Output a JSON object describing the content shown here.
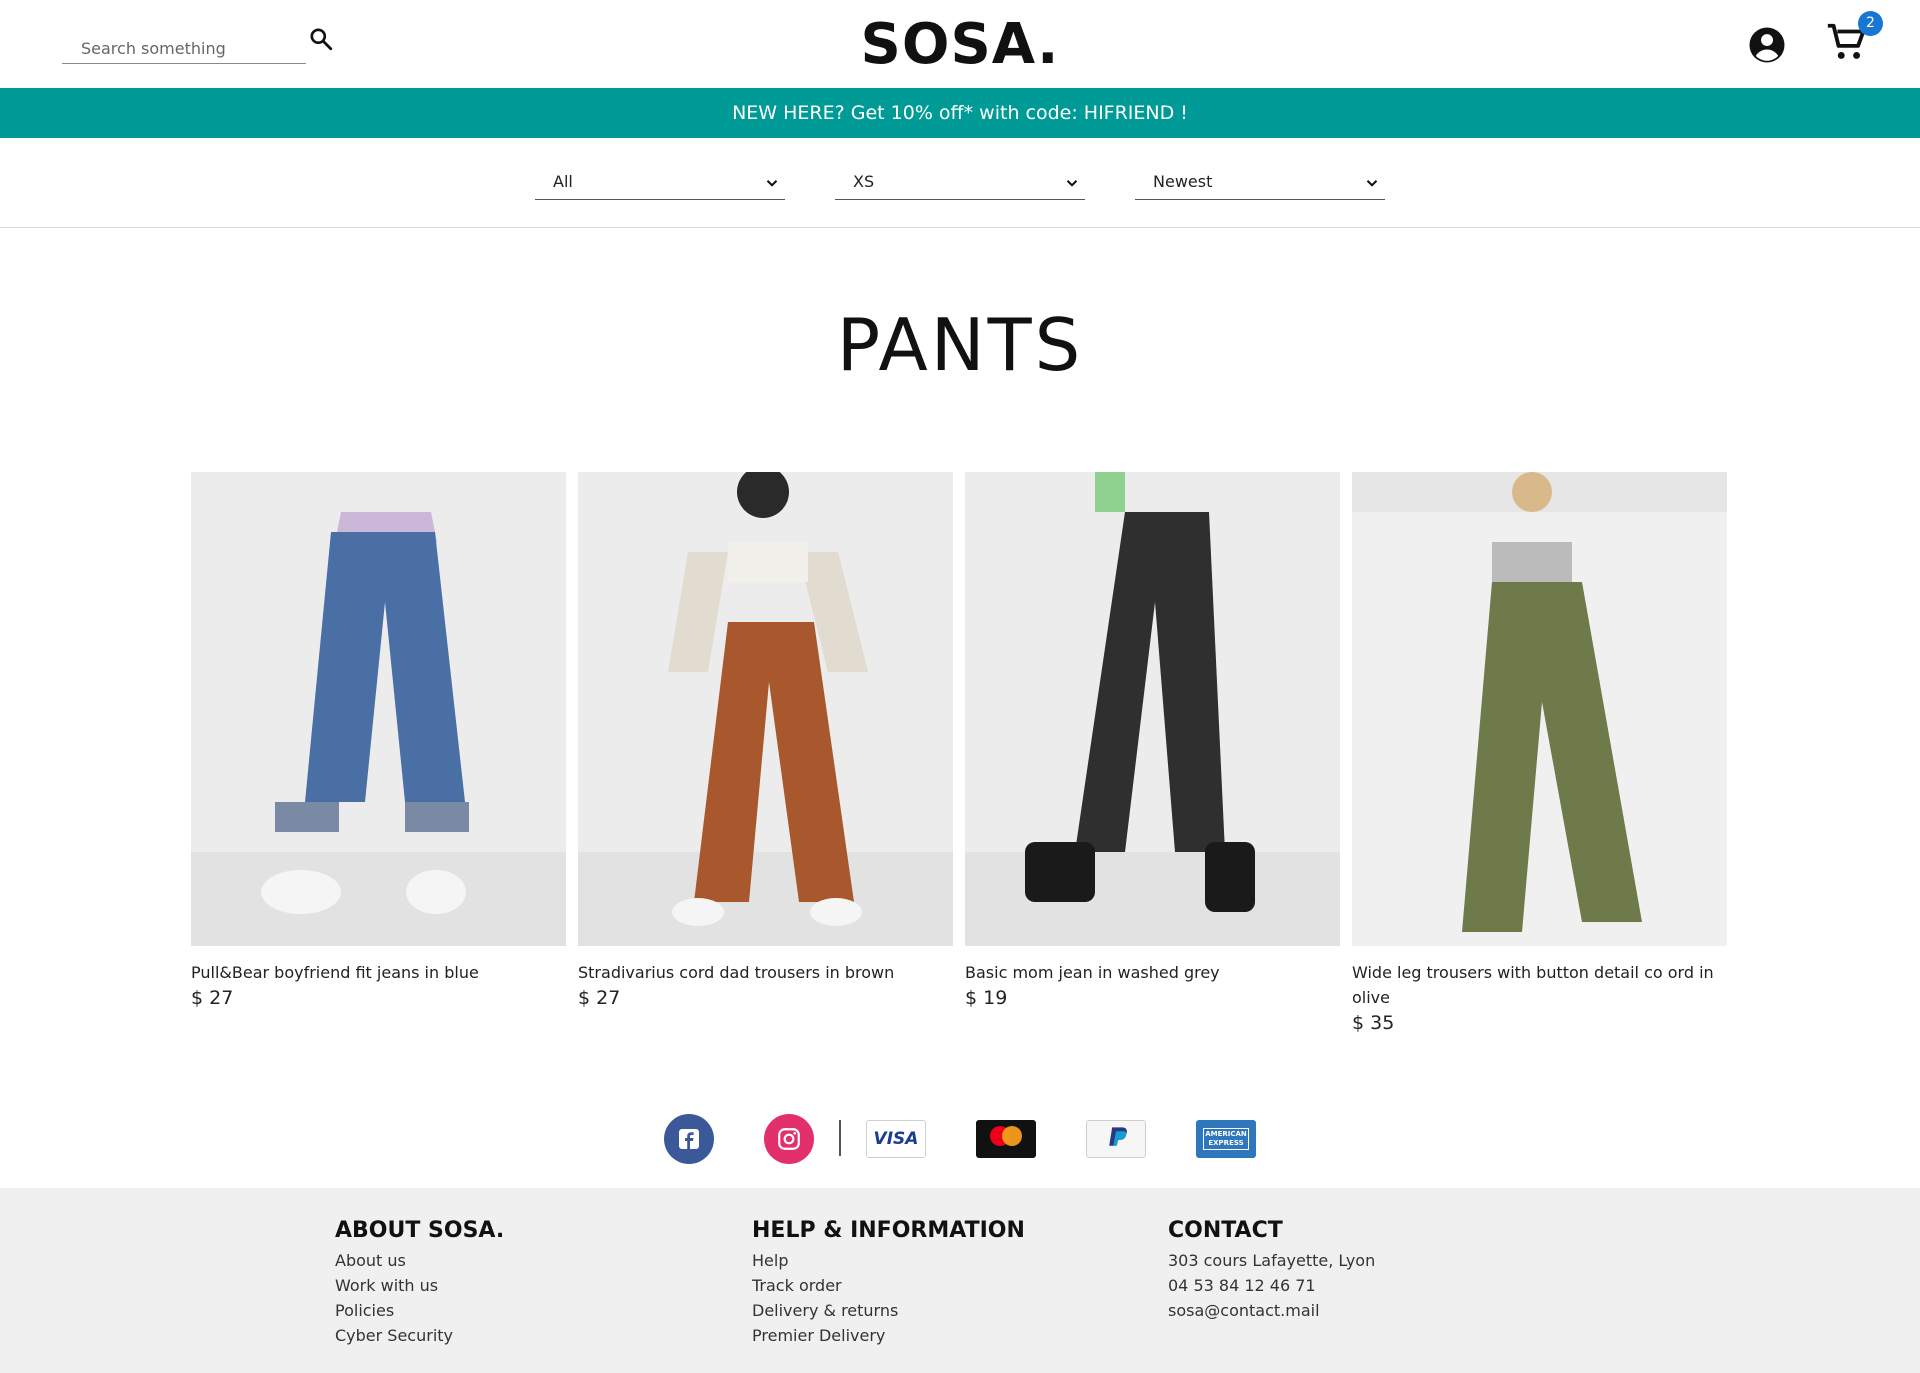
{
  "header": {
    "search_placeholder": "Search something",
    "logo": "SOSA.",
    "cart_count": "2"
  },
  "promo": {
    "text": "NEW HERE? Get 10% off* with code: HIFRIEND !"
  },
  "filters": [
    {
      "value": "All"
    },
    {
      "value": "XS"
    },
    {
      "value": "Newest"
    }
  ],
  "page_title": "PANTS",
  "products": [
    {
      "name": "Pull&Bear boyfriend fit jeans in blue",
      "price": "$ 27",
      "color": "#4a6fa5"
    },
    {
      "name": "Stradivarius cord dad trousers in brown",
      "price": "$ 27",
      "color": "#a8582c"
    },
    {
      "name": "Basic mom jean in washed grey",
      "price": "$ 19",
      "color": "#2f2f30"
    },
    {
      "name": "Wide leg trousers with button detail co ord in olive",
      "price": "$ 35",
      "color": "#6f7a4a"
    }
  ],
  "social": [
    {
      "name": "facebook",
      "color": "#3b5998"
    },
    {
      "name": "instagram",
      "color": "#e1306c"
    }
  ],
  "payments": [
    {
      "name": "visa",
      "label": "VISA"
    },
    {
      "name": "mastercard",
      "label": "mastercard"
    },
    {
      "name": "paypal",
      "label": "PayPal"
    },
    {
      "name": "amex",
      "label": "AMERICAN EXPRESS"
    }
  ],
  "footer": {
    "about": {
      "heading": "ABOUT SOSA.",
      "links": [
        "About us",
        "Work with us",
        "Policies",
        "Cyber Security"
      ]
    },
    "help": {
      "heading": "HELP & INFORMATION",
      "links": [
        "Help",
        "Track order",
        "Delivery & returns",
        "Premier Delivery"
      ]
    },
    "contact": {
      "heading": "CONTACT",
      "lines": [
        "303 cours Lafayette, Lyon",
        "04 53 84 12 46 71",
        "sosa@contact.mail"
      ]
    }
  }
}
